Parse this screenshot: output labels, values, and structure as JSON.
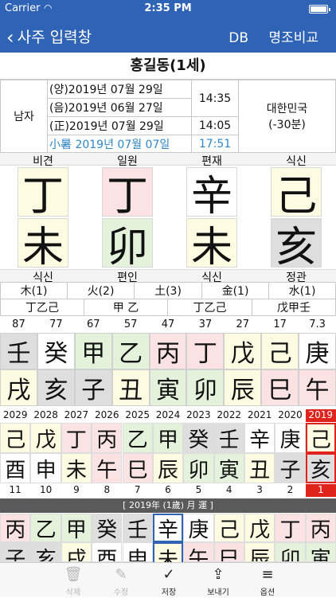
{
  "status": {
    "carrier": "Carrier",
    "time": "2:35 PM"
  },
  "nav": {
    "back": "사주 입력창",
    "db": "DB",
    "compare": "명조비교"
  },
  "person": {
    "title": "홍길동(1세)"
  },
  "info": {
    "gender": "남자",
    "solar": "(양)2019년 07월 29일",
    "lunar": "(음)2019년 06월 27일",
    "corrected": "(正)2019년 07월 29일",
    "solar_term": "小暑 2019년 07월 07일",
    "time1": "14:35",
    "time2": "14:05",
    "term_time": "17:51",
    "country": "대한민국",
    "offset": "(-30분)"
  },
  "pillars": {
    "top_labels": [
      "비견",
      "일원",
      "편재",
      "식신"
    ],
    "stems": [
      "丁",
      "丁",
      "辛",
      "己"
    ],
    "branches": [
      "未",
      "卯",
      "未",
      "亥"
    ],
    "bottom_labels": [
      "식신",
      "편인",
      "식신",
      "정관"
    ]
  },
  "elements": [
    "木(1)",
    "火(2)",
    "土(3)",
    "金(1)",
    "水(1)"
  ],
  "hidden_stems": [
    "丁乙己",
    "甲 乙",
    "丁乙己",
    "戊甲壬"
  ],
  "daeun": {
    "ages": [
      "87",
      "77",
      "67",
      "57",
      "47",
      "37",
      "27",
      "17",
      "7.3"
    ],
    "stems": [
      "壬",
      "癸",
      "甲",
      "乙",
      "丙",
      "丁",
      "戊",
      "己",
      "庚"
    ],
    "branches": [
      "戌",
      "亥",
      "子",
      "丑",
      "寅",
      "卯",
      "辰",
      "巳",
      "午"
    ]
  },
  "yearly": {
    "years": [
      "2029",
      "2028",
      "2027",
      "2026",
      "2025",
      "2024",
      "2023",
      "2022",
      "2021",
      "2020",
      "2019"
    ],
    "stems": [
      "己",
      "戊",
      "丁",
      "丙",
      "乙",
      "甲",
      "癸",
      "壬",
      "辛",
      "庚",
      "己"
    ],
    "branches": [
      "酉",
      "申",
      "未",
      "午",
      "巳",
      "辰",
      "卯",
      "寅",
      "丑",
      "子",
      "亥"
    ],
    "ages": [
      "11",
      "10",
      "9",
      "8",
      "7",
      "6",
      "5",
      "4",
      "3",
      "2",
      "1"
    ]
  },
  "monthly": {
    "header": "[ 2019年 (1歲) 月 運 ]",
    "stems": [
      "丙",
      "乙",
      "甲",
      "癸",
      "壬",
      "辛",
      "庚",
      "己",
      "戊",
      "丁",
      "丙"
    ],
    "branches": [
      "子",
      "亥",
      "戌",
      "酉",
      "申",
      "未",
      "午",
      "巳",
      "辰",
      "卯",
      "寅"
    ]
  },
  "toolbar": {
    "delete": "삭제",
    "edit": "수정",
    "save": "저장",
    "send": "보내기",
    "options": "옵션"
  }
}
